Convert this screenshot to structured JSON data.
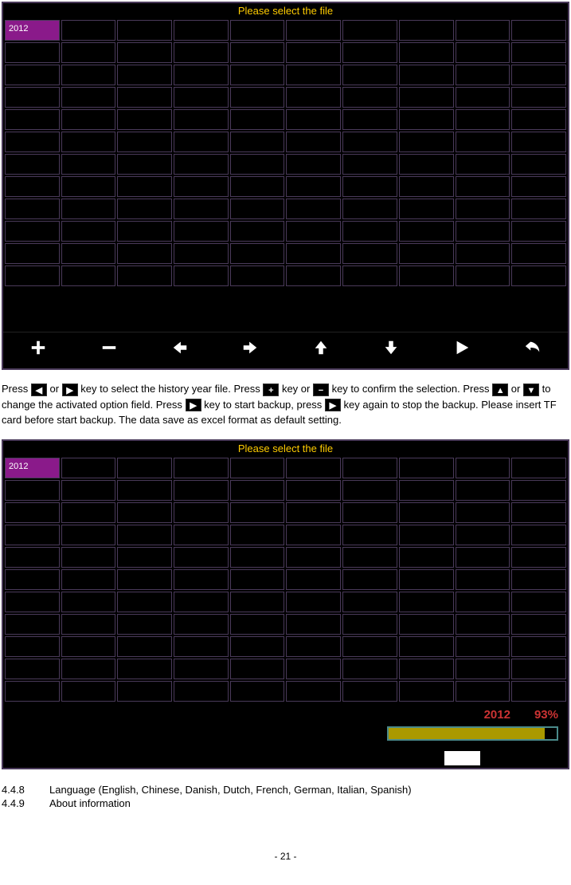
{
  "screen1": {
    "title": "Please select the file",
    "selected_cell": "2012"
  },
  "screen2": {
    "title": "Please select the file",
    "selected_cell": "2012",
    "progress_label": "2012",
    "progress_percent": "93%"
  },
  "instruction": {
    "t1": "Press ",
    "t2": " or ",
    "t3": " key to select the history year file. Press ",
    "t4": " key or ",
    "t5": " key to confirm the selection. Press ",
    "t6": " or ",
    "t7": " to change the activated option field. Press ",
    "t8": " key to start backup, press ",
    "t9": " key again to stop the backup. Please insert TF card before start backup. The data save as excel format as default setting."
  },
  "sections": {
    "item1_num": "4.4.8",
    "item1_text": "Language (English, Chinese, Danish, Dutch, French, German, Italian, Spanish)",
    "item2_num": "4.4.9",
    "item2_text": "About information"
  },
  "page_number": "- 21 -",
  "toolbar_icons": [
    "plus",
    "minus",
    "left",
    "right",
    "up",
    "down",
    "play",
    "back"
  ]
}
